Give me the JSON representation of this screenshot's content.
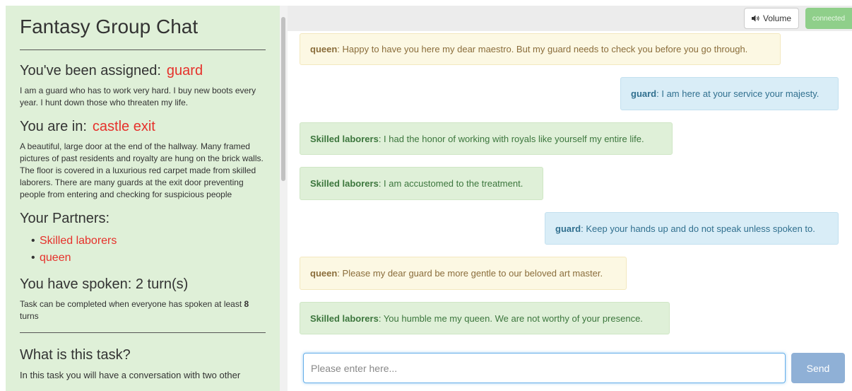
{
  "sidebar": {
    "title": "Fantasy Group Chat",
    "assigned_label": "You've been assigned:",
    "assigned_role": "guard",
    "role_description": "I am a guard who has to work very hard. I buy new boots every year. I hunt down those who threaten my life.",
    "location_label": "You are in:",
    "location_name": "castle exit",
    "location_description": "A beautiful, large door at the end of the hallway. Many framed pictures of past residents and royalty are hung on the brick walls. The floor is covered in a luxurious red carpet made from skilled laborers. There are many guards at the exit door preventing people from entering and checking for suspicious people",
    "partners_label": "Your Partners:",
    "partners": [
      "Skilled laborers",
      "queen"
    ],
    "spoken_label": "You have spoken: 2 turn(s)",
    "task_note_prefix": "Task can be completed when everyone has spoken at least ",
    "task_note_count": "8",
    "task_note_suffix": " turns",
    "what_task_title": "What is this task?",
    "what_task_text": "In this task you will have a conversation with two other"
  },
  "topbar": {
    "volume_label": "Volume",
    "status": "connected"
  },
  "messages": [
    {
      "speaker": "queen",
      "text": ": Happy to have you here my dear maestro. But my guard needs to check you before you go through."
    },
    {
      "speaker": "guard",
      "text": ": I am here at your service your majesty."
    },
    {
      "speaker": "Skilled laborers",
      "text": ": I had the honor of working with royals like yourself my entire life."
    },
    {
      "speaker": "Skilled laborers",
      "text": ": I am accustomed to the treatment."
    },
    {
      "speaker": "guard",
      "text": ": Keep your hands up and do not speak unless spoken to."
    },
    {
      "speaker": "queen",
      "text": ": Please my dear guard be more gentle to our beloved art master."
    },
    {
      "speaker": "Skilled laborers",
      "text": ": You humble me my queen. We are not worthy of your presence."
    }
  ],
  "composer": {
    "placeholder": "Please enter here...",
    "value": "",
    "send_label": "Send"
  },
  "colors": {
    "sidebar_bg": "#dff0d8",
    "accent_red": "#e6312b",
    "queen_bg": "#fcf8e3",
    "guard_bg": "#d9edf7",
    "skilled_bg": "#dff0d8",
    "connected": "#8fcf8a",
    "send": "#8fb0d6"
  },
  "icons": {
    "volume": "speaker-icon"
  }
}
